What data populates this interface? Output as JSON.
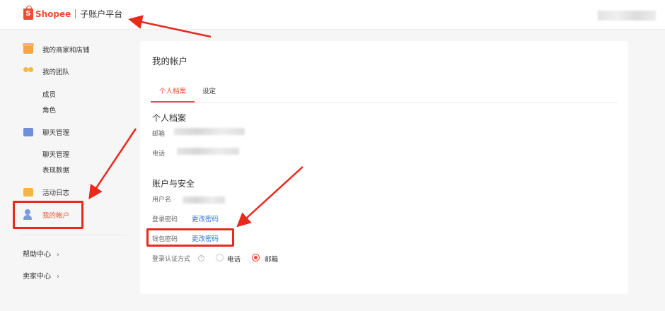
{
  "topbar": {
    "brand": "Shopee",
    "brand_icon": "S",
    "platform": "子账户平台"
  },
  "sidebar": {
    "items": [
      {
        "label": "我的商家和店铺",
        "icon": "store-icon"
      },
      {
        "label": "我的团队",
        "icon": "team-icon"
      },
      {
        "label": "聊天管理",
        "icon": "chat-icon"
      },
      {
        "label": "活动日志",
        "icon": "activity-log-icon"
      },
      {
        "label": "我的帐户",
        "icon": "account-icon"
      }
    ],
    "team_sub": [
      "成员",
      "角色"
    ],
    "chat_sub": [
      "聊天管理",
      "表现数据"
    ],
    "help": "帮助中心",
    "seller": "卖家中心"
  },
  "main": {
    "title": "我的帐户",
    "tabs": [
      "个人档案",
      "设定"
    ],
    "profile": {
      "title": "个人档案",
      "email_label": "邮箱",
      "phone_label": "电话"
    },
    "security": {
      "title": "账户与安全",
      "username_label": "用户名",
      "login_pwd_label": "登录密码",
      "login_pwd_action": "更改密码",
      "wallet_pwd_label": "钱包密码",
      "wallet_pwd_action": "更改密码",
      "auth_label": "登录认证方式",
      "auth_help": "?",
      "auth_options": [
        {
          "label": "电话",
          "selected": false
        },
        {
          "label": "邮箱",
          "selected": true
        }
      ]
    }
  },
  "colors": {
    "accent": "#ee4d2d",
    "link": "#2673dd",
    "annotation": "#e8291c"
  }
}
